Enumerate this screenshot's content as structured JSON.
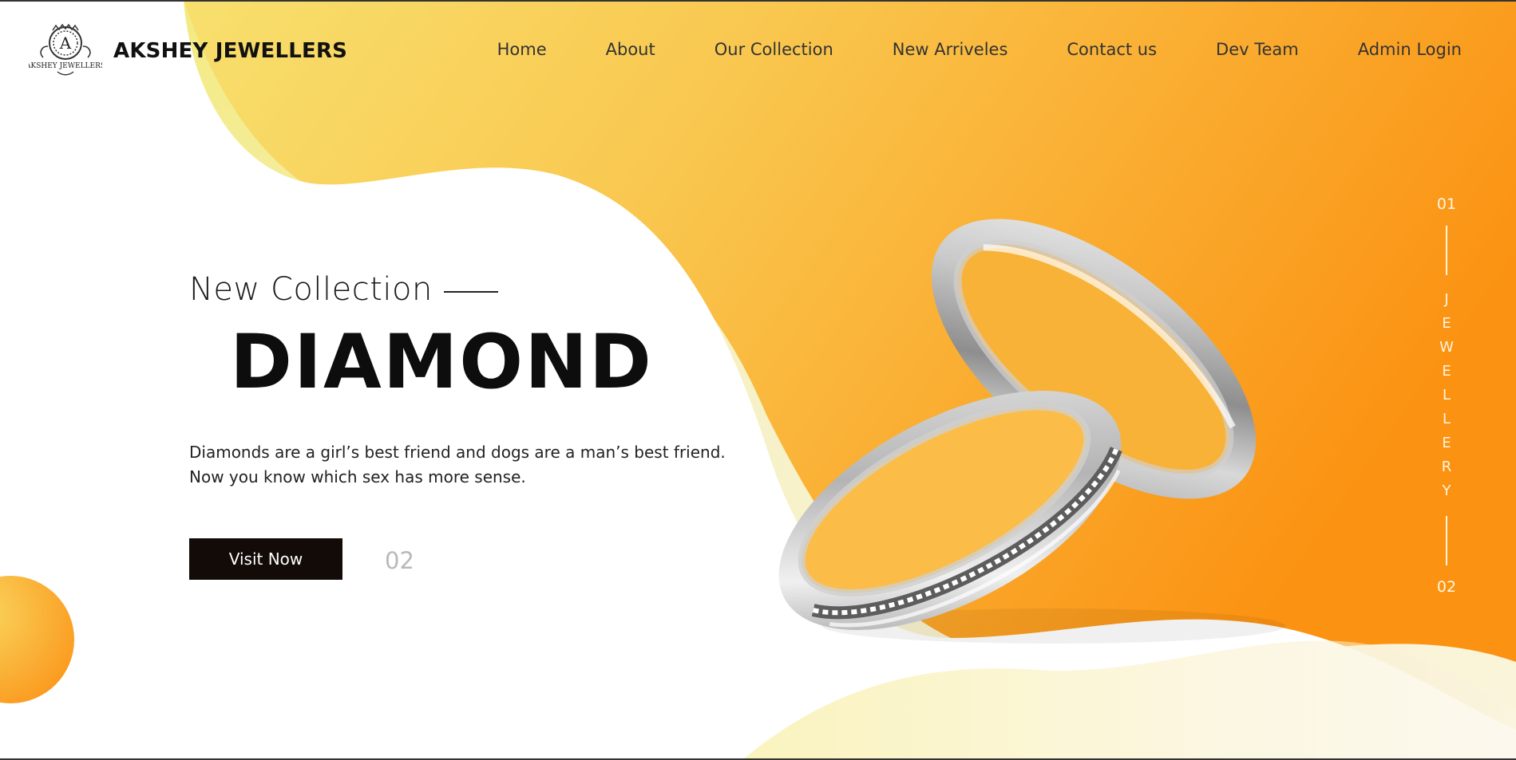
{
  "brand": {
    "name": "AKSHEY JEWELLERS",
    "logo_letter": "A",
    "logo_text": "AKSHEY JEWELLERS"
  },
  "nav": {
    "items": [
      "Home",
      "About",
      "Our Collection",
      "New Arriveles",
      "Contact us",
      "Dev Team",
      "Admin Login"
    ]
  },
  "hero": {
    "eyebrow": "New Collection",
    "headline": "DIAMOND",
    "description": "Diamonds are a girl’s best friend and dogs are a man’s best friend. Now you know which sex has more sense.",
    "cta_label": "Visit Now",
    "slide_number": "02"
  },
  "side_indicator": {
    "top": "01",
    "word_letters": [
      "J",
      "E",
      "W",
      "E",
      "L",
      "L",
      "E",
      "R",
      "Y"
    ],
    "bottom": "02"
  },
  "colors": {
    "accent_yellow": "#f7df6c",
    "accent_orange": "#fb9413",
    "button_dark": "#120b08"
  },
  "icons": {
    "logo": "monogram-crest-icon",
    "product": "wedding-rings-image"
  }
}
